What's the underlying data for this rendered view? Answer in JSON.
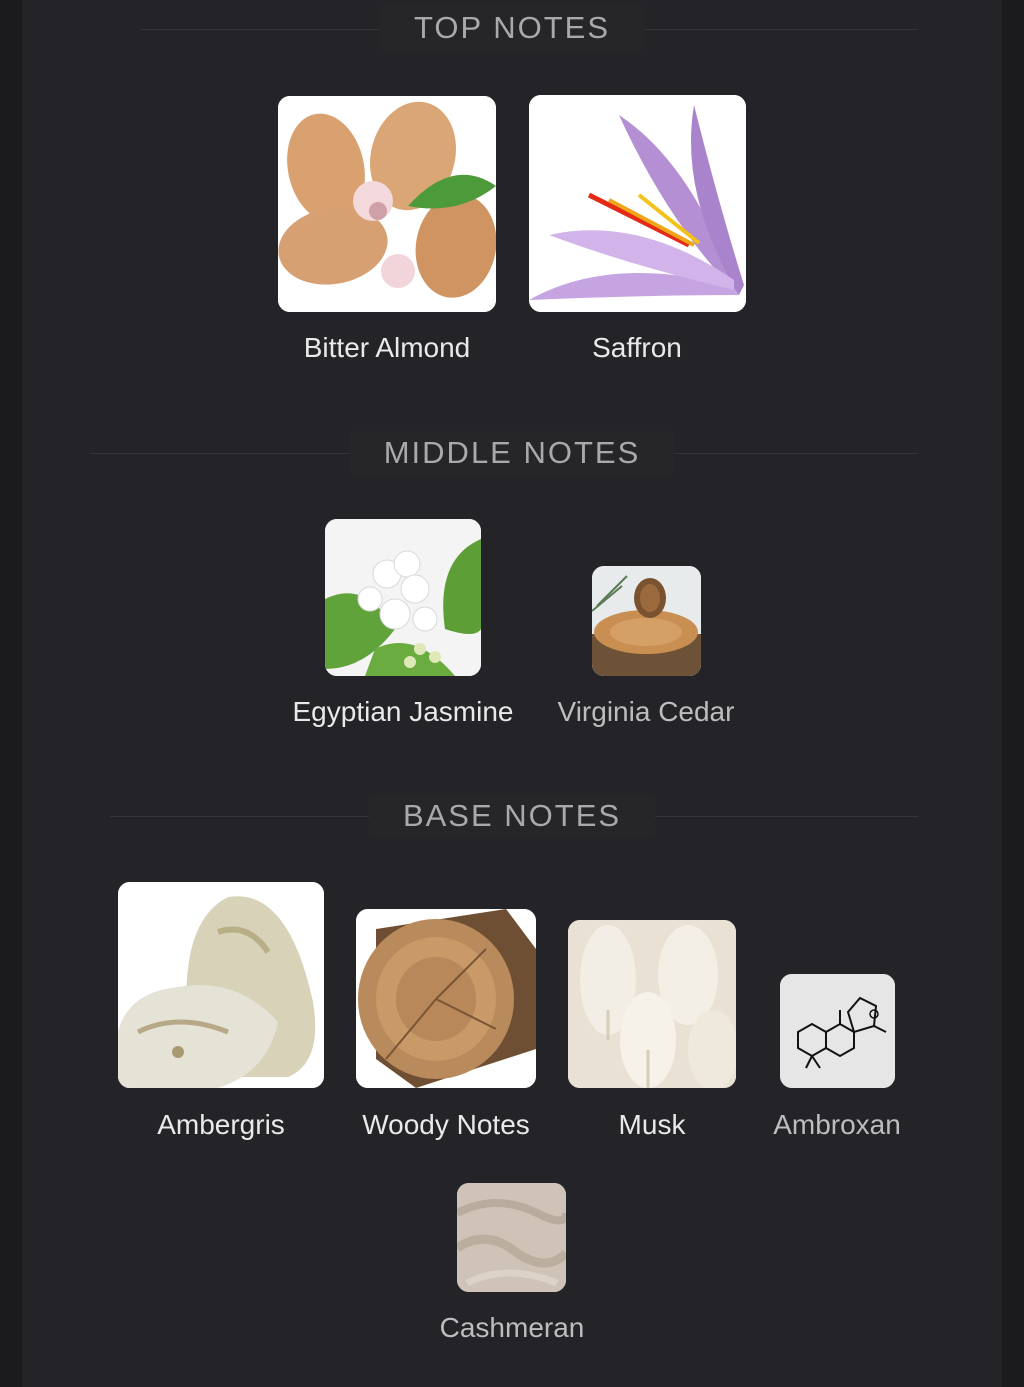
{
  "sections": {
    "top": {
      "title": "TOP NOTES",
      "notes": [
        {
          "label": "Bitter Almond",
          "icon": "almond-image"
        },
        {
          "label": "Saffron",
          "icon": "saffron-flower-image"
        }
      ]
    },
    "middle": {
      "title": "MIDDLE NOTES",
      "notes": [
        {
          "label": "Egyptian Jasmine",
          "icon": "jasmine-flower-image"
        },
        {
          "label": "Virginia Cedar",
          "icon": "cedar-wood-image"
        }
      ]
    },
    "base": {
      "title": "BASE NOTES",
      "notes": [
        {
          "label": "Ambergris",
          "icon": "ambergris-stone-image"
        },
        {
          "label": "Woody Notes",
          "icon": "wood-log-image"
        },
        {
          "label": "Musk",
          "icon": "musk-fluff-image"
        },
        {
          "label": "Ambroxan",
          "icon": "ambroxan-molecule-image"
        },
        {
          "label": "Cashmeran",
          "icon": "cashmere-fabric-image"
        }
      ]
    }
  },
  "colors": {
    "background": "#1b1b1e",
    "panel": "#242428",
    "title_text": "#a9a9ad",
    "label_text": "#e9e9ea"
  }
}
